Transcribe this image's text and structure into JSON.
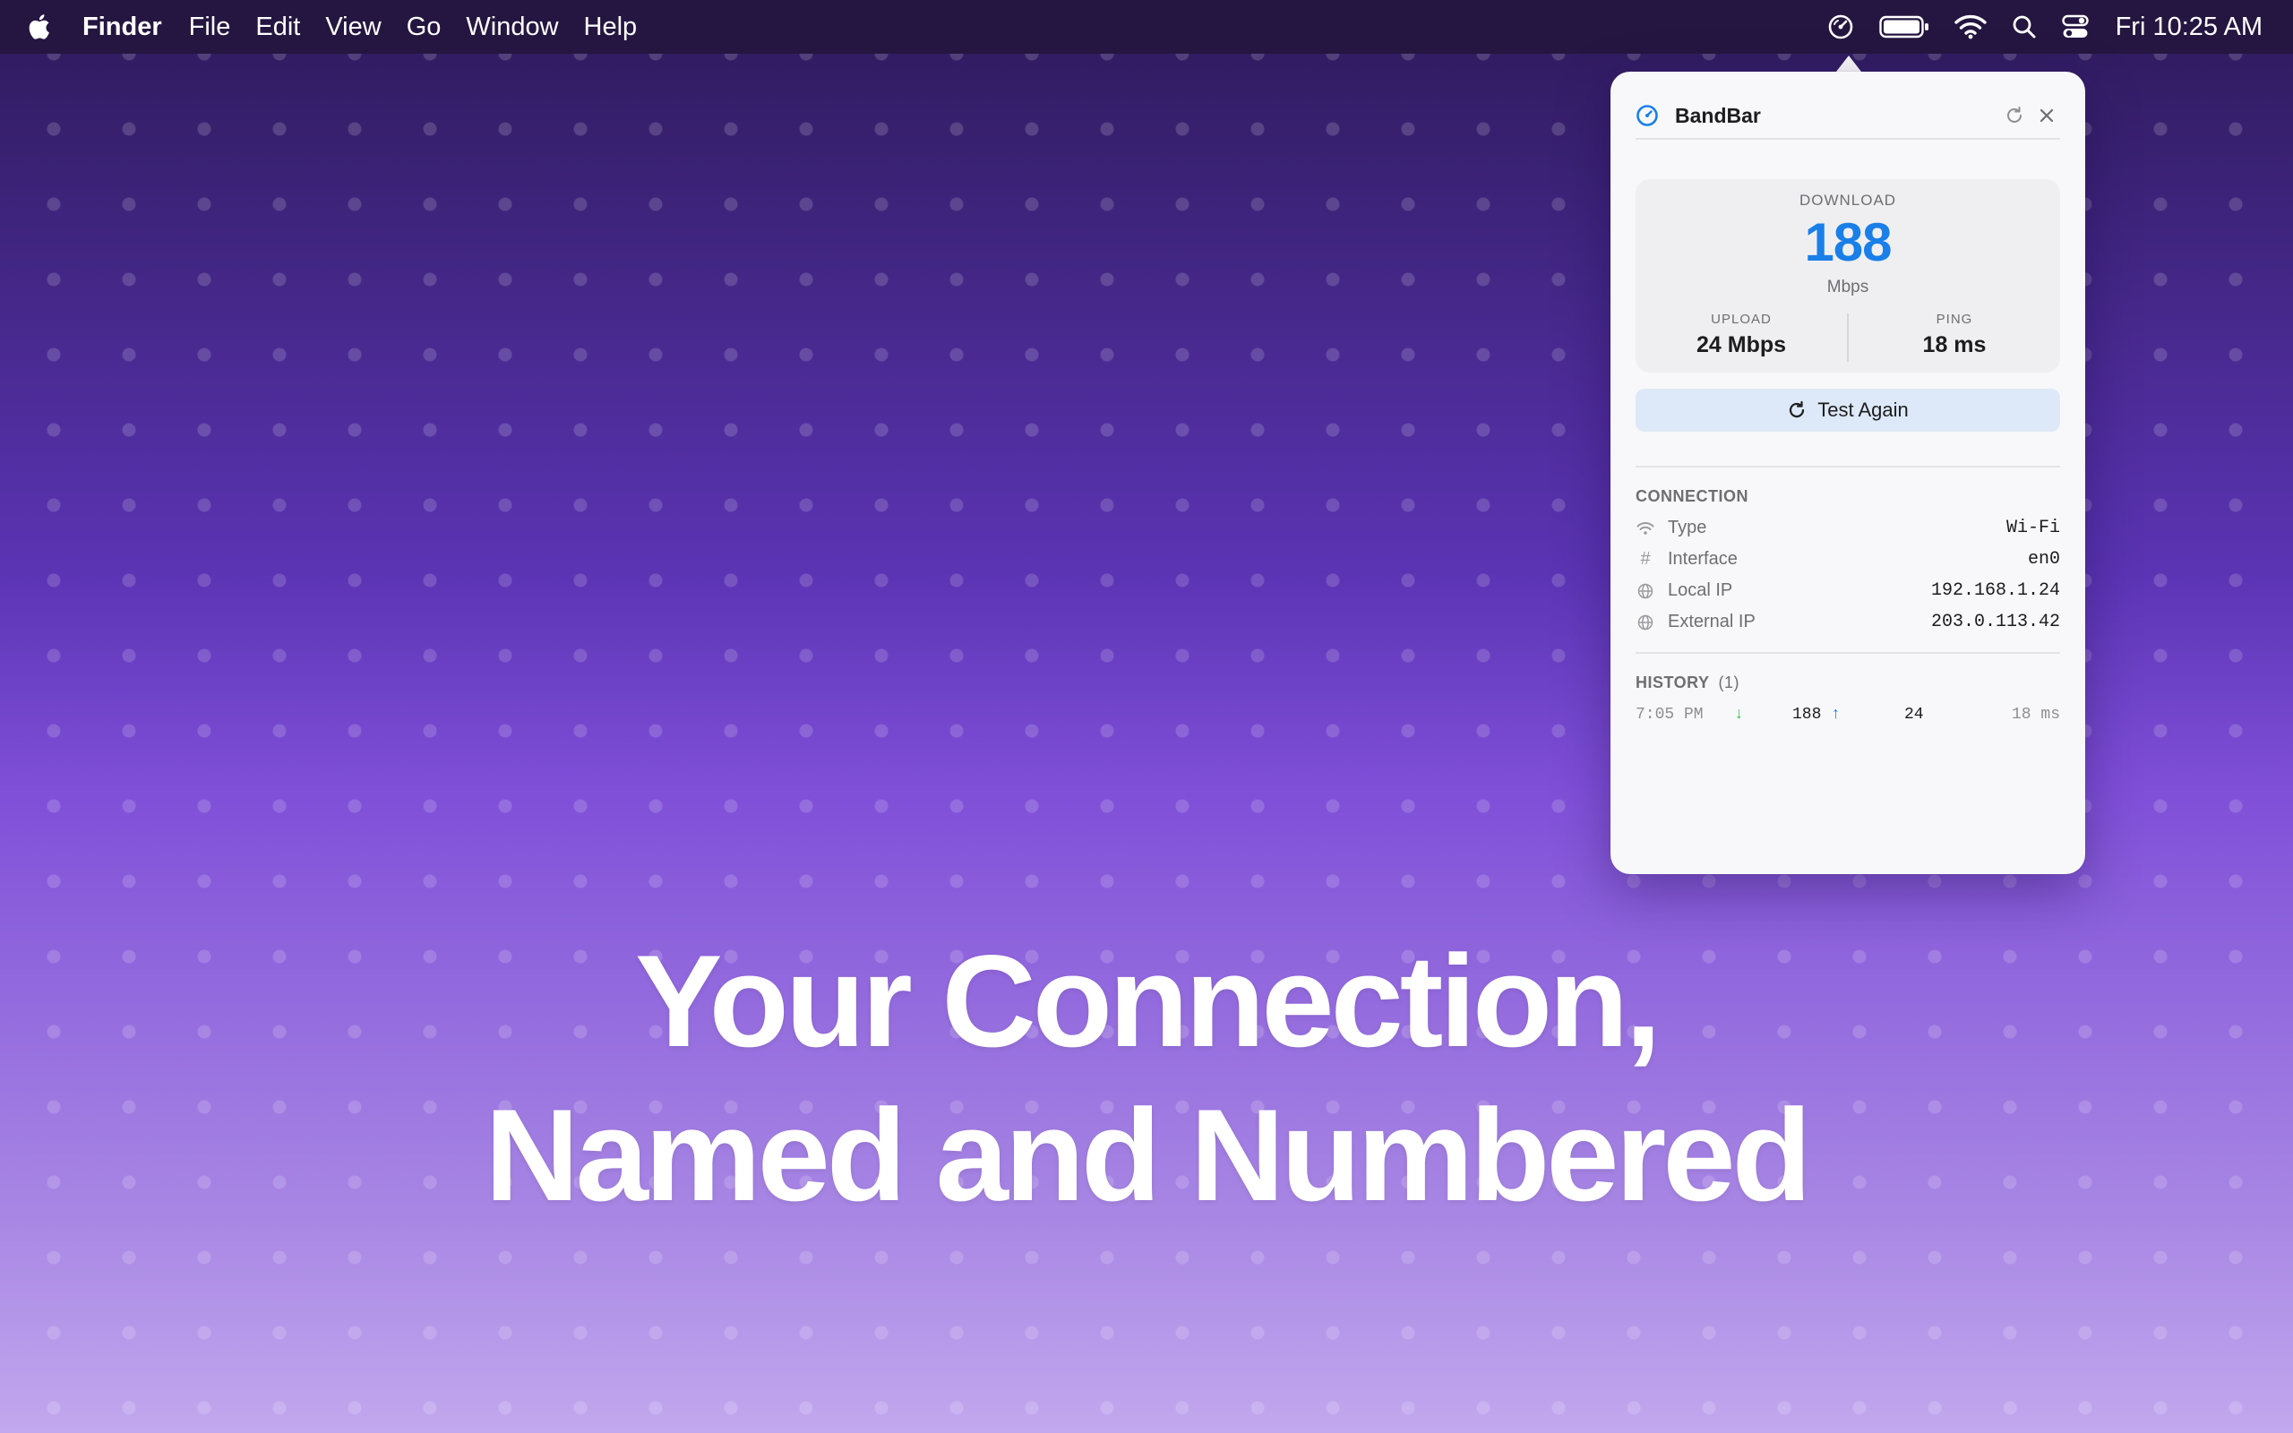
{
  "menubar": {
    "app_name": "Finder",
    "menus": [
      "File",
      "Edit",
      "View",
      "Go",
      "Window",
      "Help"
    ],
    "clock": "Fri 10:25 AM",
    "status_icons": [
      "speedometer-icon",
      "battery-icon",
      "wifi-icon",
      "search-icon",
      "control-center-icon"
    ]
  },
  "headline": {
    "line1": "Your Connection,",
    "line2": "Named and Numbered"
  },
  "popover": {
    "app_title": "BandBar",
    "download": {
      "label": "DOWNLOAD",
      "value": "188",
      "unit": "Mbps"
    },
    "upload": {
      "label": "UPLOAD",
      "value": "24 Mbps"
    },
    "ping": {
      "label": "PING",
      "value": "18 ms"
    },
    "test_button": "Test Again",
    "connection": {
      "title": "CONNECTION",
      "rows": [
        {
          "icon": "wifi-icon",
          "key": "Type",
          "value": "Wi-Fi"
        },
        {
          "icon": "hash-icon",
          "key": "Interface",
          "value": "en0"
        },
        {
          "icon": "globe-icon",
          "key": "Local IP",
          "value": "192.168.1.24"
        },
        {
          "icon": "globe-icon",
          "key": "External IP",
          "value": "203.0.113.42"
        }
      ]
    },
    "history": {
      "title": "HISTORY",
      "count": "(1)",
      "rows": [
        {
          "time": "7:05 PM",
          "download": "188",
          "upload": "24",
          "ping": "18 ms"
        }
      ]
    }
  },
  "colors": {
    "accent_blue": "#1a7fe8",
    "download_arrow": "#34c759",
    "menubar_bg": "#241640"
  }
}
